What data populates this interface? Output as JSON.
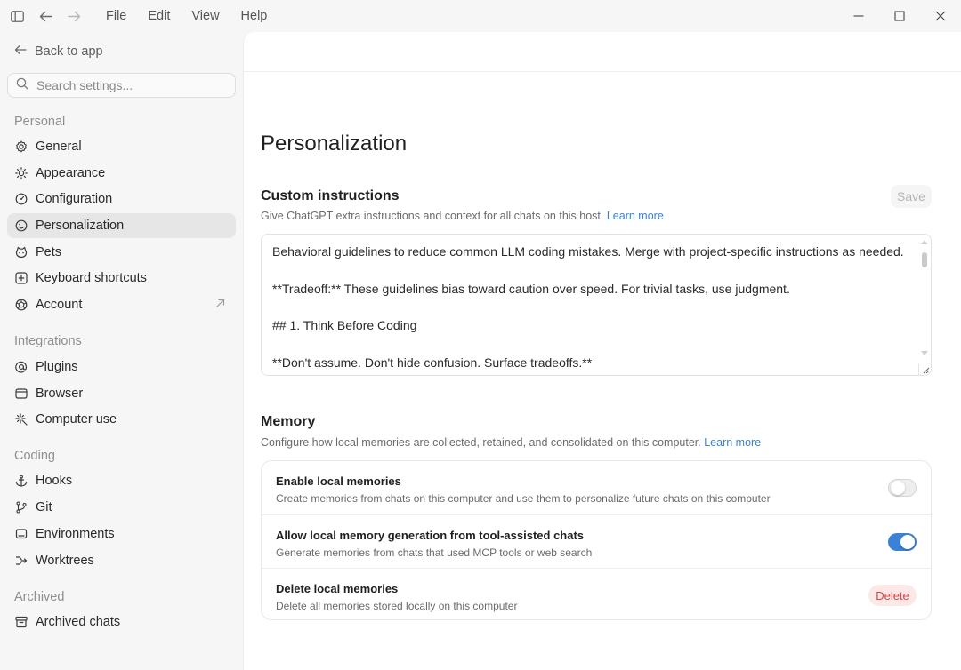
{
  "titlebar": {
    "menu": [
      "File",
      "Edit",
      "View",
      "Help"
    ]
  },
  "sidebar": {
    "back_label": "Back to app",
    "search_placeholder": "Search settings...",
    "sections": {
      "personal": "Personal",
      "integrations": "Integrations",
      "coding": "Coding",
      "archived": "Archived"
    },
    "items": {
      "general": "General",
      "appearance": "Appearance",
      "configuration": "Configuration",
      "personalization": "Personalization",
      "pets": "Pets",
      "keyboard_shortcuts": "Keyboard shortcuts",
      "account": "Account",
      "plugins": "Plugins",
      "browser": "Browser",
      "computer_use": "Computer use",
      "hooks": "Hooks",
      "git": "Git",
      "environments": "Environments",
      "worktrees": "Worktrees",
      "archived_chats": "Archived chats"
    },
    "active_item": "Personalization"
  },
  "main": {
    "page_title": "Personalization",
    "custom_instructions": {
      "title": "Custom instructions",
      "description": "Give ChatGPT extra instructions and context for all chats on this host.",
      "learn_more": "Learn more",
      "save_label": "Save",
      "lines": [
        "Behavioral guidelines to reduce common LLM coding mistakes. Merge with project-specific instructions as needed.",
        "**Tradeoff:** These guidelines bias toward caution over speed. For trivial tasks, use judgment.",
        "## 1. Think Before Coding",
        "**Don't assume. Don't hide confusion. Surface tradeoffs.**"
      ]
    },
    "memory": {
      "title": "Memory",
      "description": "Configure how local memories are collected, retained, and consolidated on this computer.",
      "learn_more": "Learn more",
      "rows": [
        {
          "title": "Enable local memories",
          "description": "Create memories from chats on this computer and use them to personalize future chats on this computer",
          "enabled": false
        },
        {
          "title": "Allow local memory generation from tool-assisted chats",
          "description": "Generate memories from chats that used MCP tools or web search",
          "enabled": true
        },
        {
          "title": "Delete local memories",
          "description": "Delete all memories stored locally on this computer",
          "action_label": "Delete"
        }
      ]
    }
  },
  "colors": {
    "accent": "#3b82d6",
    "danger": "#d64545",
    "danger_bg": "#fde8e8"
  }
}
